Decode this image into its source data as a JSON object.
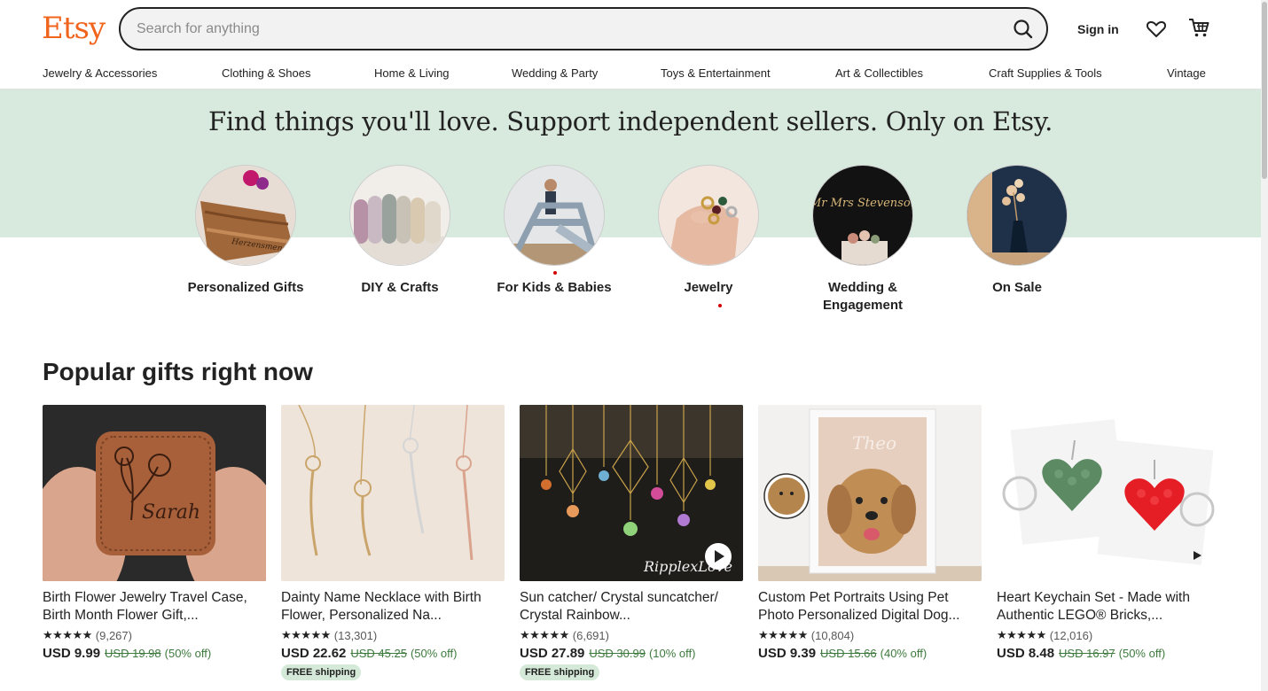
{
  "brand": {
    "logo_text": "Etsy",
    "accent": "#f1641e"
  },
  "search": {
    "placeholder": "Search for anything",
    "value": ""
  },
  "header": {
    "signin_label": "Sign in",
    "favorites_icon": "heart-icon",
    "cart_icon": "cart-icon"
  },
  "categories": [
    "Jewelry & Accessories",
    "Clothing & Shoes",
    "Home & Living",
    "Wedding & Party",
    "Toys & Entertainment",
    "Art & Collectibles",
    "Craft Supplies & Tools",
    "Vintage"
  ],
  "hero": {
    "title": "Find things you'll love. Support independent sellers. Only on Etsy.",
    "background": "#d8e9dd",
    "circles": [
      {
        "label": "Personalized Gifts"
      },
      {
        "label": "DIY & Crafts"
      },
      {
        "label": "For Kids & Babies"
      },
      {
        "label": "Jewelry"
      },
      {
        "label": "Wedding & Engagement"
      },
      {
        "label": "On Sale"
      }
    ]
  },
  "popular": {
    "title": "Popular gifts right now",
    "items": [
      {
        "title": "Birth Flower Jewelry Travel Case, Birth Month Flower Gift,...",
        "stars": "★★★★★",
        "reviews": "(9,267)",
        "price": "USD 9.99",
        "original": "USD 19.98",
        "discount": "(50% off)",
        "badge": ""
      },
      {
        "title": "Dainty Name Necklace with Birth Flower, Personalized Na...",
        "stars": "★★★★★",
        "reviews": "(13,301)",
        "price": "USD 22.62",
        "original": "USD 45.25",
        "discount": "(50% off)",
        "badge": "FREE shipping"
      },
      {
        "title": "Sun catcher/ Crystal suncatcher/ Crystal Rainbow...",
        "stars": "★★★★★",
        "reviews": "(6,691)",
        "price": "USD 27.89",
        "original": "USD 30.99",
        "discount": "(10% off)",
        "badge": "FREE shipping"
      },
      {
        "title": "Custom Pet Portraits Using Pet Photo Personalized Digital Dog...",
        "stars": "★★★★★",
        "reviews": "(10,804)",
        "price": "USD 9.39",
        "original": "USD 15.66",
        "discount": "(40% off)",
        "badge": ""
      },
      {
        "title": "Heart Keychain Set - Made with Authentic LEGO® Bricks,...",
        "stars": "★★★★★",
        "reviews": "(12,016)",
        "price": "USD 8.48",
        "original": "USD 16.97",
        "discount": "(50% off)",
        "badge": ""
      }
    ]
  },
  "image_text": {
    "case_engraving": "Sarah",
    "board_engraving": "Herzensmensch",
    "suncatcher_watermark": "RipplexLove",
    "portrait_name": "Theo",
    "wedding_topper": "Mr Mrs Stevenson"
  }
}
